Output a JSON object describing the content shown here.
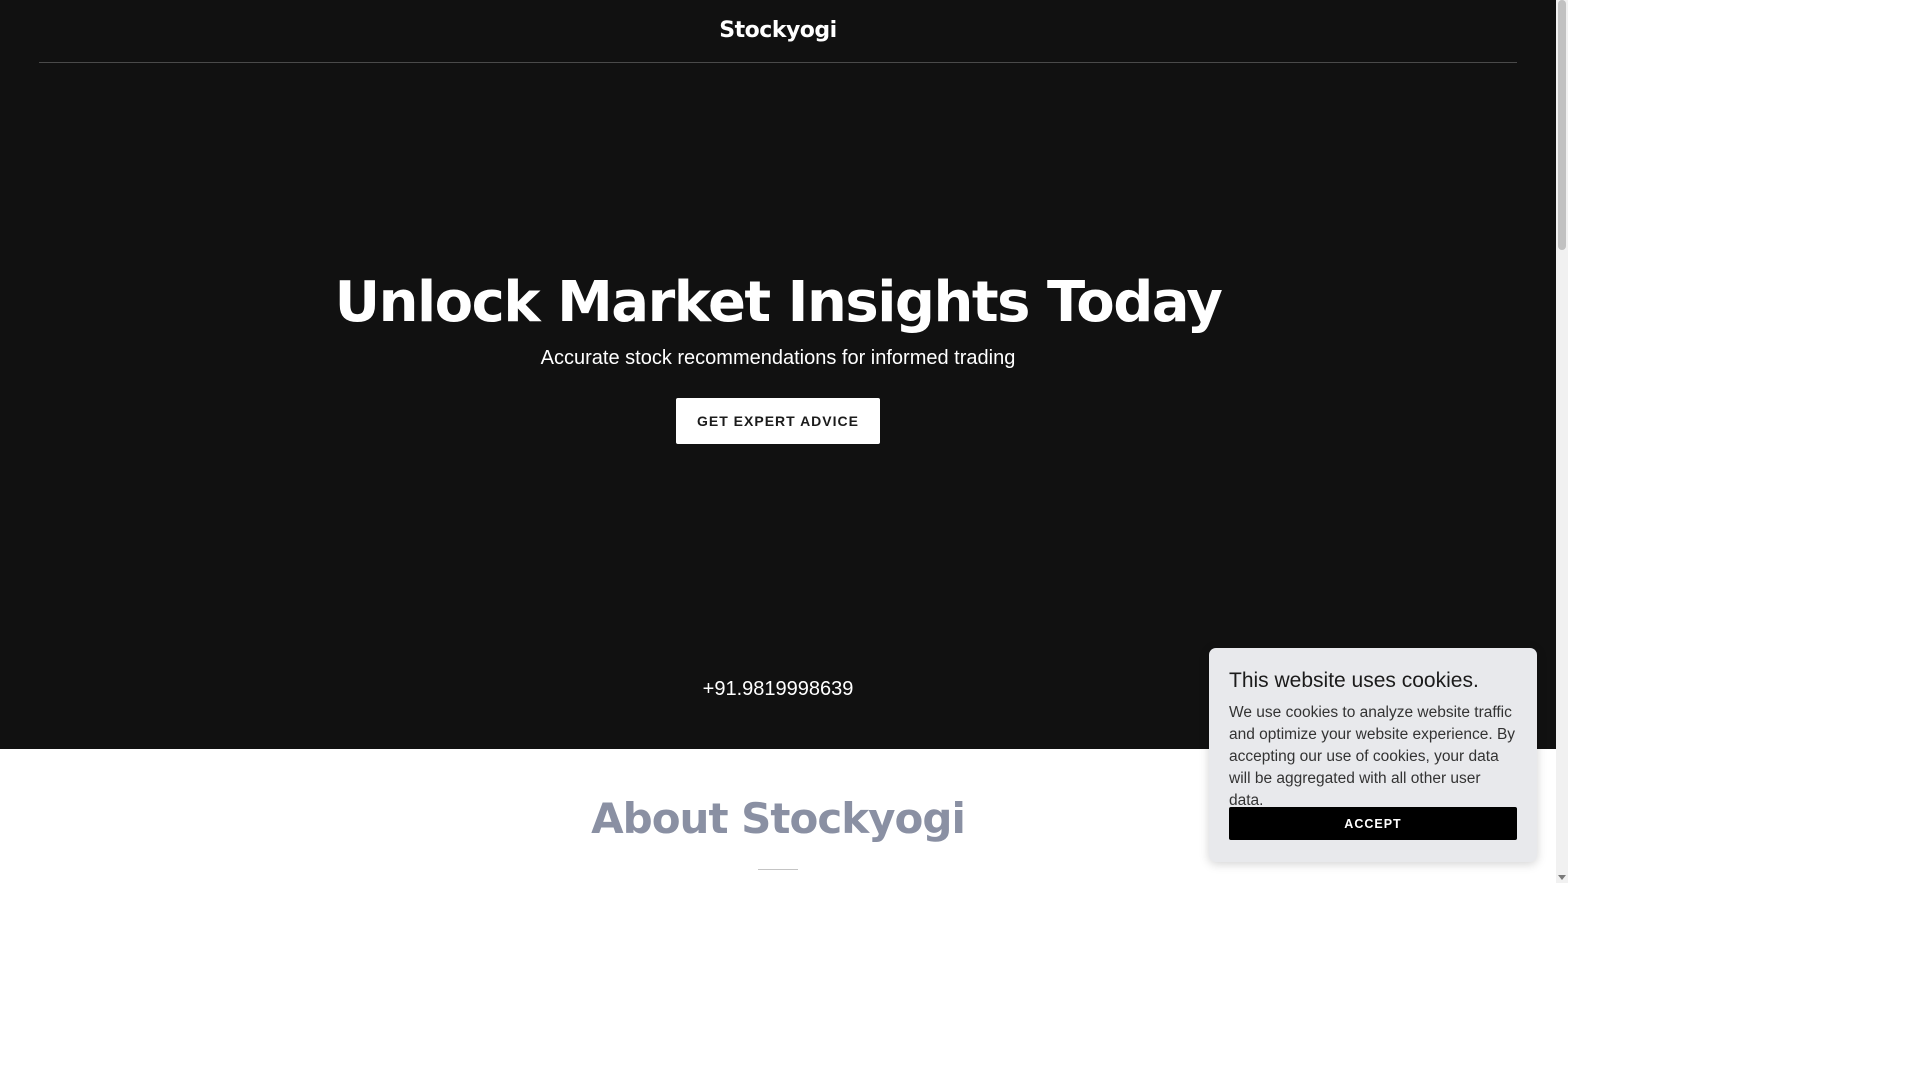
{
  "header": {
    "logo": "Stockyogi"
  },
  "hero": {
    "title": "Unlock Market Insights Today",
    "subtitle": "Accurate stock recommendations for informed trading",
    "cta_label": "GET EXPERT ADVICE",
    "phone": "+91.9819998639"
  },
  "about": {
    "title": "About Stockyogi"
  },
  "cookie_banner": {
    "title": "This website uses cookies.",
    "text": "We use cookies to analyze website traffic and optimize your website experience. By accepting our use of cookies, your data will be aggregated with all other user data.",
    "accept_label": "ACCEPT"
  },
  "colors": {
    "hero_background": "#111111",
    "about_title": "#8a90a3",
    "cookie_background": "#e8e9ec",
    "accept_button": "#000000"
  }
}
